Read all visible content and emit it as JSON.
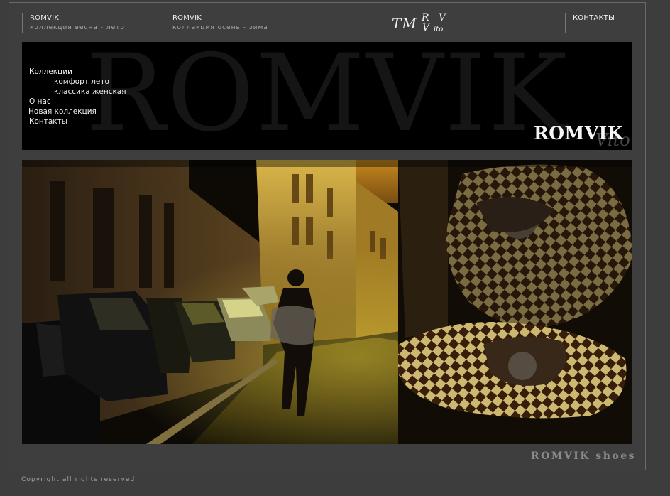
{
  "topnav": {
    "items": [
      {
        "title": "ROMVIK",
        "subtitle": "коллекция весна - лето"
      },
      {
        "title": "ROMVIK",
        "subtitle": "коллекция осень - зима"
      }
    ],
    "contacts": "КОНТАКТЫ"
  },
  "logo": {
    "tm": "TM",
    "r": "R",
    "v": "V",
    "ito": "ito"
  },
  "banner": {
    "watermark": "ROMVIK",
    "brand": "ROMVIK",
    "brand_script": "Vito"
  },
  "menu": {
    "items": [
      {
        "label": "Коллекции"
      },
      {
        "label": "комфорт лето"
      },
      {
        "label": "классика женская"
      },
      {
        "label": "О нас"
      },
      {
        "label": "Новая коллекция"
      },
      {
        "label": "Контакты"
      }
    ]
  },
  "footer": {
    "brand": "ROMVIK shoes",
    "copyright": "Copyright all rights reserved"
  }
}
